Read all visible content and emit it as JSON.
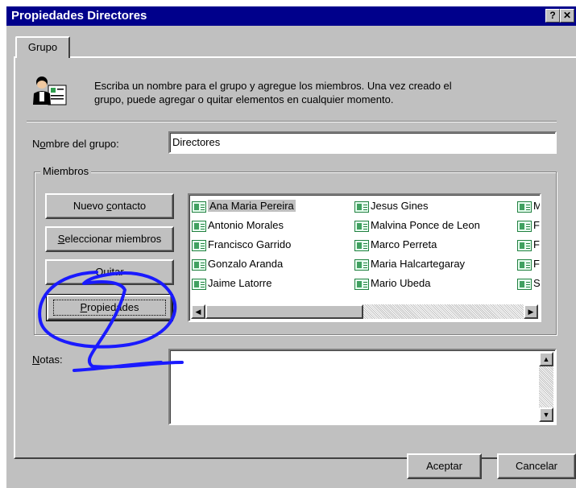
{
  "window": {
    "title": "Propiedades Directores",
    "help_button": "?",
    "close_button": "✕"
  },
  "tabs": [
    {
      "label": "Grupo"
    }
  ],
  "intro": {
    "line1": "Escriba un nombre para el grupo y agregue los miembros. Una vez creado el",
    "line2": "grupo, puede agregar o quitar elementos en cualquier momento."
  },
  "group_name": {
    "label_prefix": "N",
    "label_ul": "o",
    "label_rest": "mbre del grupo:",
    "value": "Directores"
  },
  "members": {
    "legend": "Miembros",
    "buttons": {
      "nuevo_contacto": {
        "pre": "Nuevo ",
        "ul": "c",
        "post": "ontacto"
      },
      "seleccionar": {
        "pre": "",
        "ul": "S",
        "post": "eleccionar miembros"
      },
      "quitar": {
        "pre": "",
        "ul": "Q",
        "post": "uitar"
      },
      "propiedades": {
        "pre": "",
        "ul": "P",
        "post": "ropiedades"
      }
    },
    "list": {
      "col1": [
        "Ana Maria Pereira",
        "Antonio Morales",
        "Francisco Garrido",
        "Gonzalo Aranda",
        "Jaime Latorre"
      ],
      "col2": [
        "Jesus Gines",
        "Malvina Ponce de Leon",
        "Marco Perreta",
        "Maria Halcartegaray",
        "Mario Ubeda"
      ],
      "col3": [
        "M",
        "F",
        "F",
        "F",
        "S"
      ],
      "selected": "Ana Maria Pereira"
    }
  },
  "notes": {
    "label_ul": "N",
    "label_rest": "otas:",
    "value": ""
  },
  "footer": {
    "accept": "Aceptar",
    "cancel": "Cancelar"
  },
  "colors": {
    "titlebar": "#00008b",
    "face": "#c0c0c0",
    "annotation": "#1a1aff"
  }
}
